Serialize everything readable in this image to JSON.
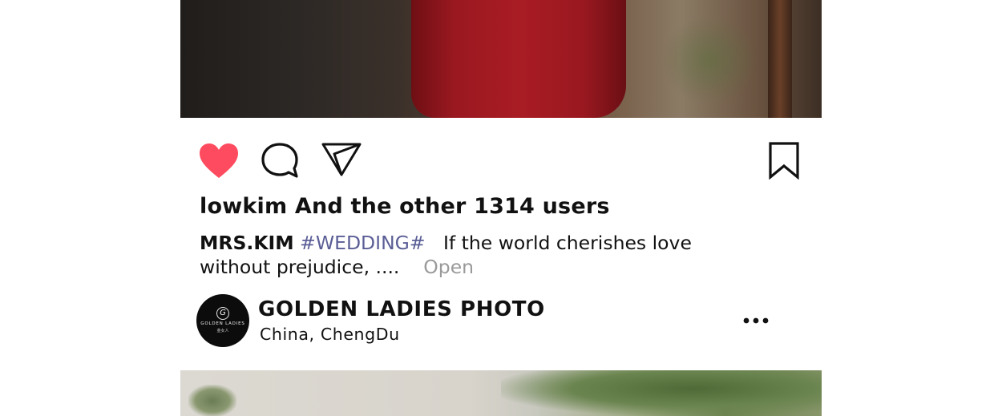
{
  "post": {
    "likes_summary": "lowkim And the other 1314 users",
    "caption": {
      "author": "MRS.KIM",
      "hashtag": "#WEDDING#",
      "text": "If the world cherishes love without prejudice, ....",
      "open_label": "Open"
    },
    "account": {
      "name": "GOLDEN LADIES PHOTO",
      "location_country": "China,",
      "location_city": "ChengDu",
      "avatar_logo_text": "GOLDEN LADIES",
      "avatar_logo_subtext": "金女人"
    },
    "icons": {
      "like": "heart-icon",
      "comment": "speech-bubble-icon",
      "share": "paper-plane-icon",
      "bookmark": "bookmark-icon",
      "more": "more-dots-icon"
    },
    "colors": {
      "like": "#ff4b5f",
      "hashtag": "#5b5e96",
      "open_link": "#9a9a9a",
      "text": "#111111"
    }
  }
}
